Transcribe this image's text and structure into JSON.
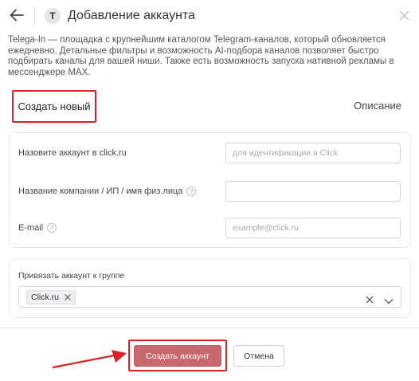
{
  "header": {
    "logo_letter": "T",
    "title": "Добавление аккаунта"
  },
  "description": "Telega-In — площадка с крупнейшим каталогом Telegram-каналов, который обновляется ежедневно. Детальные фильтры и возможность AI-подбора каналов позволяет быстро подбирать каналы для вашей ниши. Также есть возможность запуска нативной рекламы в мессенджере MAX.",
  "tabs": {
    "create_new": "Создать новый",
    "description": "Описание"
  },
  "form": {
    "account_name_label": "Назовите аккаунт в click.ru",
    "account_name_placeholder": "для идентификации в Click",
    "account_name_value": "",
    "company_label": "Название компании / ИП / имя физ.лица",
    "company_value": "",
    "email_label": "E-mail",
    "email_placeholder": "example@click.ru",
    "email_value": ""
  },
  "group": {
    "label": "Привязать аккаунт к группе",
    "selected_tag": "Click.ru"
  },
  "footer": {
    "submit_label": "Создать аккаунт",
    "cancel_label": "Отмена"
  },
  "colors": {
    "accent_highlight": "#e02020",
    "submit_bg": "#c9686d"
  },
  "icons": {
    "back": "arrow-left-icon",
    "close": "close-icon",
    "help": "question-circle-icon",
    "tag_remove": "close-icon",
    "clear": "close-icon",
    "dropdown": "chevron-down-icon"
  }
}
